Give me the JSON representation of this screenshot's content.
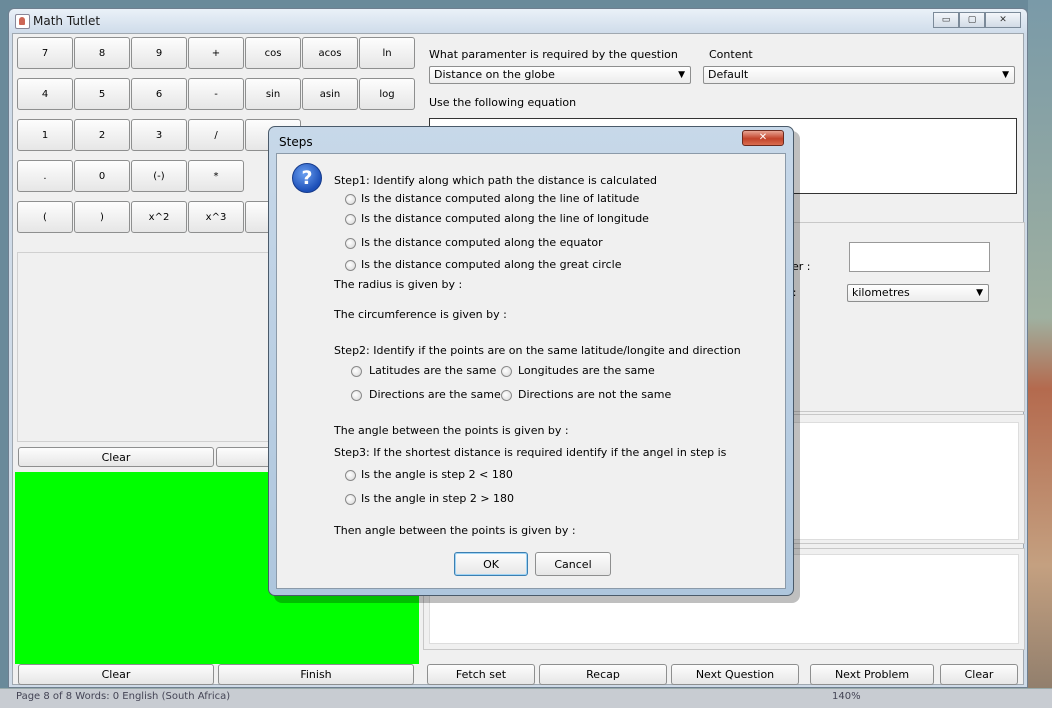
{
  "window": {
    "title": "Math Tutlet",
    "minimize": "▭",
    "maximize": "▢",
    "close": "✕"
  },
  "keypad": {
    "rows": [
      [
        "7",
        "8",
        "9",
        "+",
        "cos",
        "acos",
        "ln"
      ],
      [
        "4",
        "5",
        "6",
        "-",
        "sin",
        "asin",
        "log"
      ],
      [
        "1",
        "2",
        "3",
        "/",
        "ta"
      ],
      [
        ".",
        "0",
        "(-)",
        "*"
      ],
      [
        "(",
        ")",
        "x^2",
        "x^3",
        "x"
      ]
    ]
  },
  "left_buttons": {
    "clear_top": "Clear",
    "clear_bottom": "Clear",
    "finish": "Finish"
  },
  "right": {
    "param_label": "What paramenter is required by the question",
    "param_value": "Distance on the globe",
    "content_label": "Content",
    "content_value": "Default",
    "equation_label": "Use the following equation",
    "answer_label": "wer :",
    "units_label": "s:",
    "units_value": "kilometres"
  },
  "bottom_buttons": {
    "fetch": "Fetch set",
    "recap": "Recap",
    "next_question": "Next Question",
    "next_problem": "Next Problem",
    "clear": "Clear"
  },
  "dialog": {
    "title": "Steps",
    "close": "✕",
    "step1": "Step1: Identify along which path the distance is calculated",
    "step1_options": [
      "Is the distance computed along the line of latitude",
      "Is the distance computed along the line of longitude",
      "Is the distance  computed along the equator",
      "Is the distance computed  along the great circle"
    ],
    "radius": "The radius is given by :",
    "circumference": "The circumference is given by :",
    "step2": "Step2: Identify if the points are on the same latitude/longite and direction",
    "lat_same": "Latitudes are the same",
    "long_same": "Longitudes are the same",
    "dir_same": "Directions are the same",
    "dir_not_same": "Directions are not the same",
    "angle": "The angle between the points is given by :",
    "step3": "Step3: If the shortest distance is required identify if the angel in step is",
    "step3_options": [
      "Is the angle is step 2 < 180",
      "Is the angle in step 2 > 180"
    ],
    "then_angle": "Then angle between the points is given by :",
    "ok": "OK",
    "cancel": "Cancel",
    "icon": "question-icon"
  },
  "taskbar": {
    "left_text": "Page 8 of 8   Words: 0     English (South Africa)",
    "zoom": "140%"
  }
}
